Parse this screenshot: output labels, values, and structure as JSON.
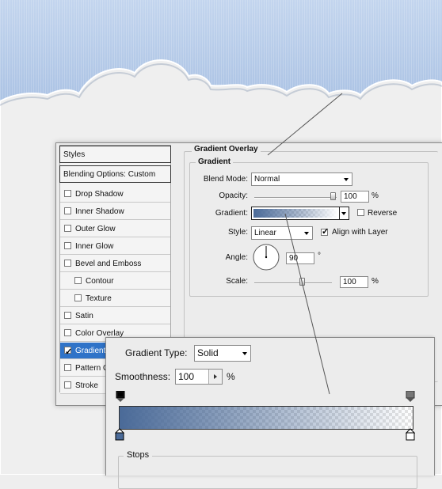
{
  "styles_panel": {
    "title": "Styles",
    "blending": "Blending Options: Custom",
    "items": [
      {
        "label": "Drop Shadow",
        "checked": false
      },
      {
        "label": "Inner Shadow",
        "checked": false
      },
      {
        "label": "Outer Glow",
        "checked": false
      },
      {
        "label": "Inner Glow",
        "checked": false
      },
      {
        "label": "Bevel and Emboss",
        "checked": false
      },
      {
        "label": "Contour",
        "checked": false
      },
      {
        "label": "Texture",
        "checked": false
      },
      {
        "label": "Satin",
        "checked": false
      },
      {
        "label": "Color Overlay",
        "checked": false
      },
      {
        "label": "Gradient Overlay",
        "checked": true
      },
      {
        "label": "Pattern Overlay",
        "checked": false
      },
      {
        "label": "Stroke",
        "checked": false
      }
    ]
  },
  "gradient_overlay": {
    "section_title": "Gradient Overlay",
    "group_title": "Gradient",
    "blend_mode_label": "Blend Mode:",
    "blend_mode_value": "Normal",
    "opacity_label": "Opacity:",
    "opacity_value": "100",
    "opacity_unit": "%",
    "opacity_level": 1.0,
    "gradient_label": "Gradient:",
    "reverse_label": "Reverse",
    "reverse_checked": false,
    "style_label": "Style:",
    "style_value": "Linear",
    "align_label": "Align with Layer",
    "align_checked": true,
    "angle_label": "Angle:",
    "angle_value": "90",
    "angle_unit": "°",
    "scale_label": "Scale:",
    "scale_value": "100",
    "scale_unit": "%",
    "scale_level": 0.5
  },
  "gradient_editor": {
    "type_label": "Gradient Type:",
    "type_value": "Solid",
    "smoothness_label": "Smoothness:",
    "smoothness_value": "100",
    "smoothness_unit": "%",
    "stops_label": "Stops"
  },
  "colors": {
    "sky": "#c9d9ee",
    "gradient_start": "#4a6a98",
    "selection": "#2f73c8"
  }
}
